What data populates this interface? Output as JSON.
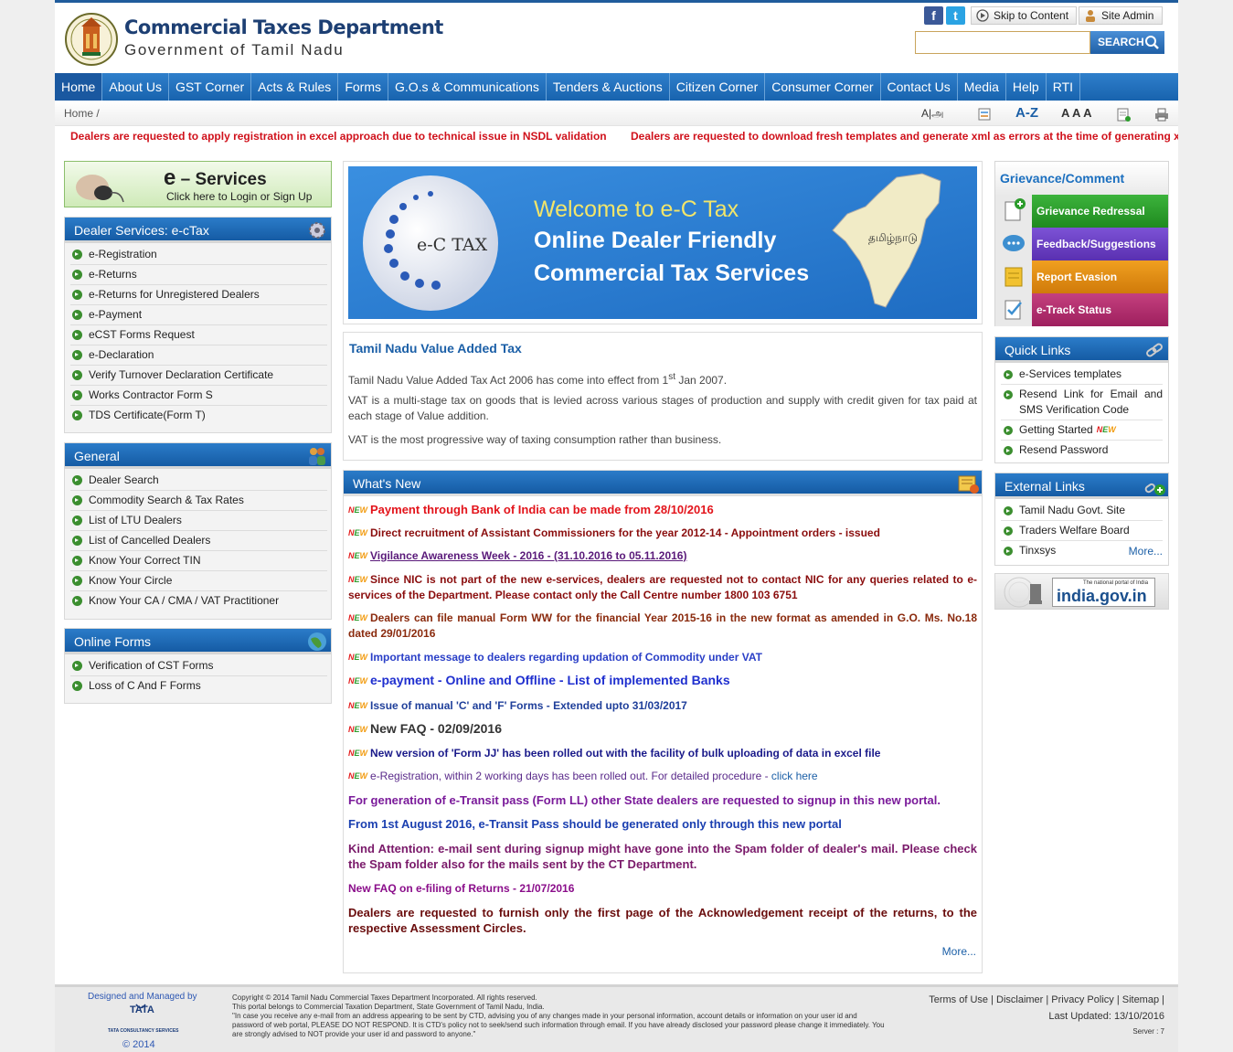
{
  "header": {
    "title": "Commercial Taxes Department",
    "subtitle": "Government of Tamil Nadu",
    "skip_label": "Skip to Content",
    "admin_label": "Site Admin",
    "search_label": "SEARCH",
    "search_placeholder": ""
  },
  "nav": [
    "Home",
    "About Us",
    "GST Corner",
    "Acts & Rules",
    "Forms",
    "G.O.s & Communications",
    "Tenders & Auctions",
    "Citizen Corner",
    "Consumer Corner",
    "Contact Us",
    "Media",
    "Help",
    "RTI"
  ],
  "breadcrumb": "Home /",
  "accessibility": {
    "font": "A|அ",
    "az": "A-Z",
    "sizes": "A A A"
  },
  "ticker": [
    "Dealers are requested to apply registration in excel approach due to technical issue in NSDL validation",
    "Dealers are requested to download fresh templates and generate xml as errors at the time of generating x"
  ],
  "eservices": {
    "title_e": "e",
    "title_rest": "– Services",
    "sub": "Click here to Login or Sign Up"
  },
  "dealer_services": {
    "title": "Dealer Services: e-cTax",
    "items": [
      "e-Registration",
      "e-Returns",
      "e-Returns for Unregistered Dealers",
      "e-Payment",
      "eCST Forms Request",
      "e-Declaration",
      "Verify Turnover Declaration Certificate",
      "Works Contractor Form S",
      "TDS Certificate(Form T)"
    ]
  },
  "general": {
    "title": "General",
    "items": [
      "Dealer Search",
      "Commodity Search & Tax Rates",
      "List of LTU Dealers",
      "List of Cancelled Dealers",
      "Know Your Correct TIN",
      "Know Your Circle",
      "Know Your CA / CMA / VAT Practitioner"
    ]
  },
  "online_forms": {
    "title": "Online Forms",
    "items": [
      "Verification of CST Forms",
      "Loss of C And F Forms"
    ]
  },
  "banner": {
    "welcome": "Welcome to e-C Tax",
    "line1": "Online Dealer Friendly",
    "line2": "Commercial Tax Services",
    "logo": "e-C TAX",
    "map_label": "தமிழ்நாடு"
  },
  "vat": {
    "title": "Tamil Nadu Value Added Tax",
    "p1_pre": "Tamil Nadu Value Added Tax Act 2006 has come into effect from 1",
    "p1_sup": "st",
    "p1_post": " Jan 2007.",
    "p2": "VAT is a multi-stage tax on goods that is levied across various stages of production and supply with credit given for tax paid at each stage of Value addition.",
    "p3": "VAT is the most progressive way of taxing consumption rather than business."
  },
  "whats_new": {
    "title": "What's New",
    "more": "More...",
    "items": [
      {
        "text": "Payment through Bank of India can be made from 28/10/2016"
      },
      {
        "text": "Direct recruitment of Assistant Commissioners for the year 2012-14 - Appointment orders - issued"
      },
      {
        "text": "Vigilance Awareness Week - 2016 - (31.10.2016 to 05.11.2016)"
      },
      {
        "text": "Since NIC is not part of the new e-services, dealers are requested not to contact NIC for any queries related to e-services of the Department.  Please contact only the Call Centre number 1800 103 6751"
      },
      {
        "text": "Dealers can file manual Form WW for the financial Year 2015-16 in the new format as amended in G.O. Ms. No.18 dated 29/01/2016"
      },
      {
        "text": "Important message to dealers regarding updation of Commodity under VAT"
      },
      {
        "text": "e-payment - Online and Offline - List of implemented Banks"
      },
      {
        "text": "Issue of manual 'C' and 'F' Forms - Extended upto 31/03/2017"
      },
      {
        "text": "New FAQ - 02/09/2016"
      },
      {
        "text": "New version of 'Form JJ' has been rolled out with the facility of bulk uploading of data in excel file"
      },
      {
        "text": "e-Registration, within 2 working days has been rolled out.  For detailed procedure - ",
        "link": "click here"
      },
      {
        "text": "For generation of e-Transit pass (Form LL) other State dealers are requested to signup in this new portal."
      },
      {
        "text": "From 1st August 2016, e-Transit Pass should be generated only through this new portal"
      },
      {
        "text": "Kind Attention: e-mail sent during signup might have gone into the Spam folder of dealer's mail. Please check the Spam folder also for the mails sent by the CT Department."
      },
      {
        "text": "New FAQ on e-filing of Returns - 21/07/2016"
      },
      {
        "text": "Dealers are requested to furnish only the first page of the Acknowledgement receipt of the returns, to the respective Assessment Circles."
      }
    ]
  },
  "grievance": {
    "title": "Grievance/Comment",
    "items": [
      "Grievance Redressal",
      "Feedback/Suggestions",
      "Report Evasion",
      "e-Track Status"
    ]
  },
  "quick_links": {
    "title": "Quick Links",
    "items": [
      "e-Services templates",
      "Resend Link for Email and SMS Verification Code",
      "Getting Started",
      "Resend Password"
    ]
  },
  "external_links": {
    "title": "External Links",
    "items": [
      "Tamil Nadu Govt. Site",
      "Traders Welfare Board",
      "Tinxsys"
    ],
    "more": "More..."
  },
  "indiagov": {
    "small": "The national portal of India",
    "big": "india.gov.in"
  },
  "footer": {
    "designed": "Designed and Managed by",
    "tata": "TATA",
    "tcs": "TATA CONSULTANCY SERVICES",
    "year": "© 2014",
    "copy1": "Copyright © 2014 Tamil Nadu Commercial Taxes Department Incorporated. All rights reserved.",
    "copy2": "This portal belongs to Commercial Taxation Department, State Government of Tamil Nadu, India.",
    "copy3": "\"In case you receive any e-mail from an address appearing to be sent by CTD, advising you of any changes made in your personal information, account details or information on your user id and password of web portal, PLEASE DO NOT RESPOND. It is CTD's policy not to seek/send such information through email. If you have already disclosed your password please change it immediately. You are strongly advised to NOT provide your user id and password to anyone.\"",
    "links": "Terms of Use | Disclaimer | Privacy Policy | Sitemap |",
    "updated": "Last Updated: 13/10/2016",
    "server": "Server : 7"
  },
  "colors": {
    "nav": "#1863ae",
    "ticker": "#d0111b",
    "green": "#3b8e2f",
    "griev1": "#2b9c2b",
    "griev2": "#6a3fc2",
    "griev3": "#e58a0f",
    "griev4": "#b52a6e"
  }
}
